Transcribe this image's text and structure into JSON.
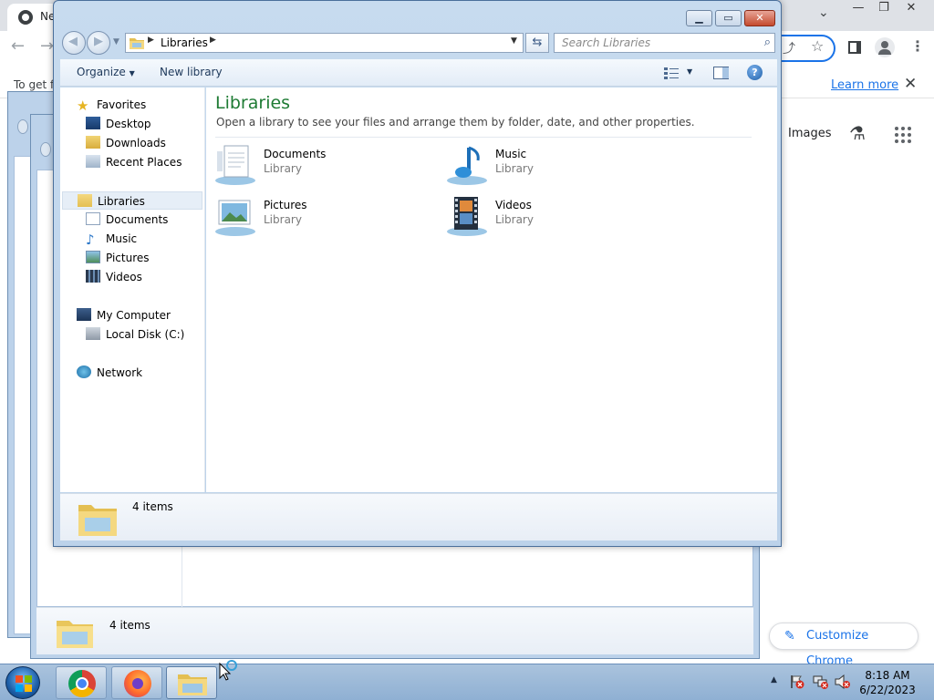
{
  "chrome": {
    "tab_title": "Ne",
    "infobar_text": "To get f",
    "learn_more": "Learn more",
    "images_link": "Images",
    "customize_label": "Customize Chrome"
  },
  "background_windows": {
    "status_text": "4 items"
  },
  "explorer": {
    "address_segment": "Libraries",
    "search_placeholder": "Search Libraries",
    "commands": {
      "organize": "Organize",
      "new_library": "New library"
    },
    "nav": {
      "favorites": "Favorites",
      "desktop": "Desktop",
      "downloads": "Downloads",
      "recent_places": "Recent Places",
      "libraries": "Libraries",
      "documents": "Documents",
      "music": "Music",
      "pictures": "Pictures",
      "videos": "Videos",
      "my_computer": "My Computer",
      "local_disk": "Local Disk (C:)",
      "network": "Network"
    },
    "content": {
      "heading": "Libraries",
      "description": "Open a library to see your files and arrange them by folder, date, and other properties.",
      "libraries": [
        {
          "name": "Documents",
          "type": "Library",
          "icon": "documents-library-icon"
        },
        {
          "name": "Music",
          "type": "Library",
          "icon": "music-library-icon"
        },
        {
          "name": "Pictures",
          "type": "Library",
          "icon": "pictures-library-icon"
        },
        {
          "name": "Videos",
          "type": "Library",
          "icon": "videos-library-icon"
        }
      ]
    },
    "status": {
      "item_count": "4 items"
    }
  },
  "taskbar": {
    "time": "8:18 AM",
    "date": "6/22/2023"
  },
  "colors": {
    "heading_green": "#1e7b34",
    "chrome_link_blue": "#1a73e8",
    "window_frame": "#bcd2ea"
  }
}
